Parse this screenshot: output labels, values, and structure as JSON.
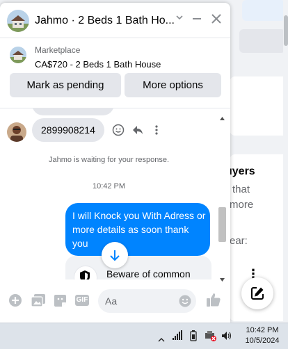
{
  "chat": {
    "title": "Jahmo · 2 Beds 1 Bath Ho...",
    "marketplace_label": "Marketplace",
    "listing": "CA$720 - 2 Beds 1 Bath House",
    "mark_pending": "Mark as pending",
    "more_options": "More options",
    "phone_message": "2899908214",
    "waiting_notice": "Jahmo is waiting for your response.",
    "timestamp": "10:42 PM",
    "sent_message": "I will Knock you With Adress or more details  as soon thank you",
    "safety_notice": "Beware of common",
    "input_placeholder": "Aa"
  },
  "background": {
    "heading": "uyers",
    "line1": "that",
    "line2": "more",
    "line3": "ear:"
  },
  "taskbar": {
    "time": "10:42 PM",
    "date": "10/5/2024"
  },
  "colors": {
    "accent": "#0084ff",
    "button_gray": "#e4e6eb",
    "icon_gray": "#8a8d91"
  }
}
